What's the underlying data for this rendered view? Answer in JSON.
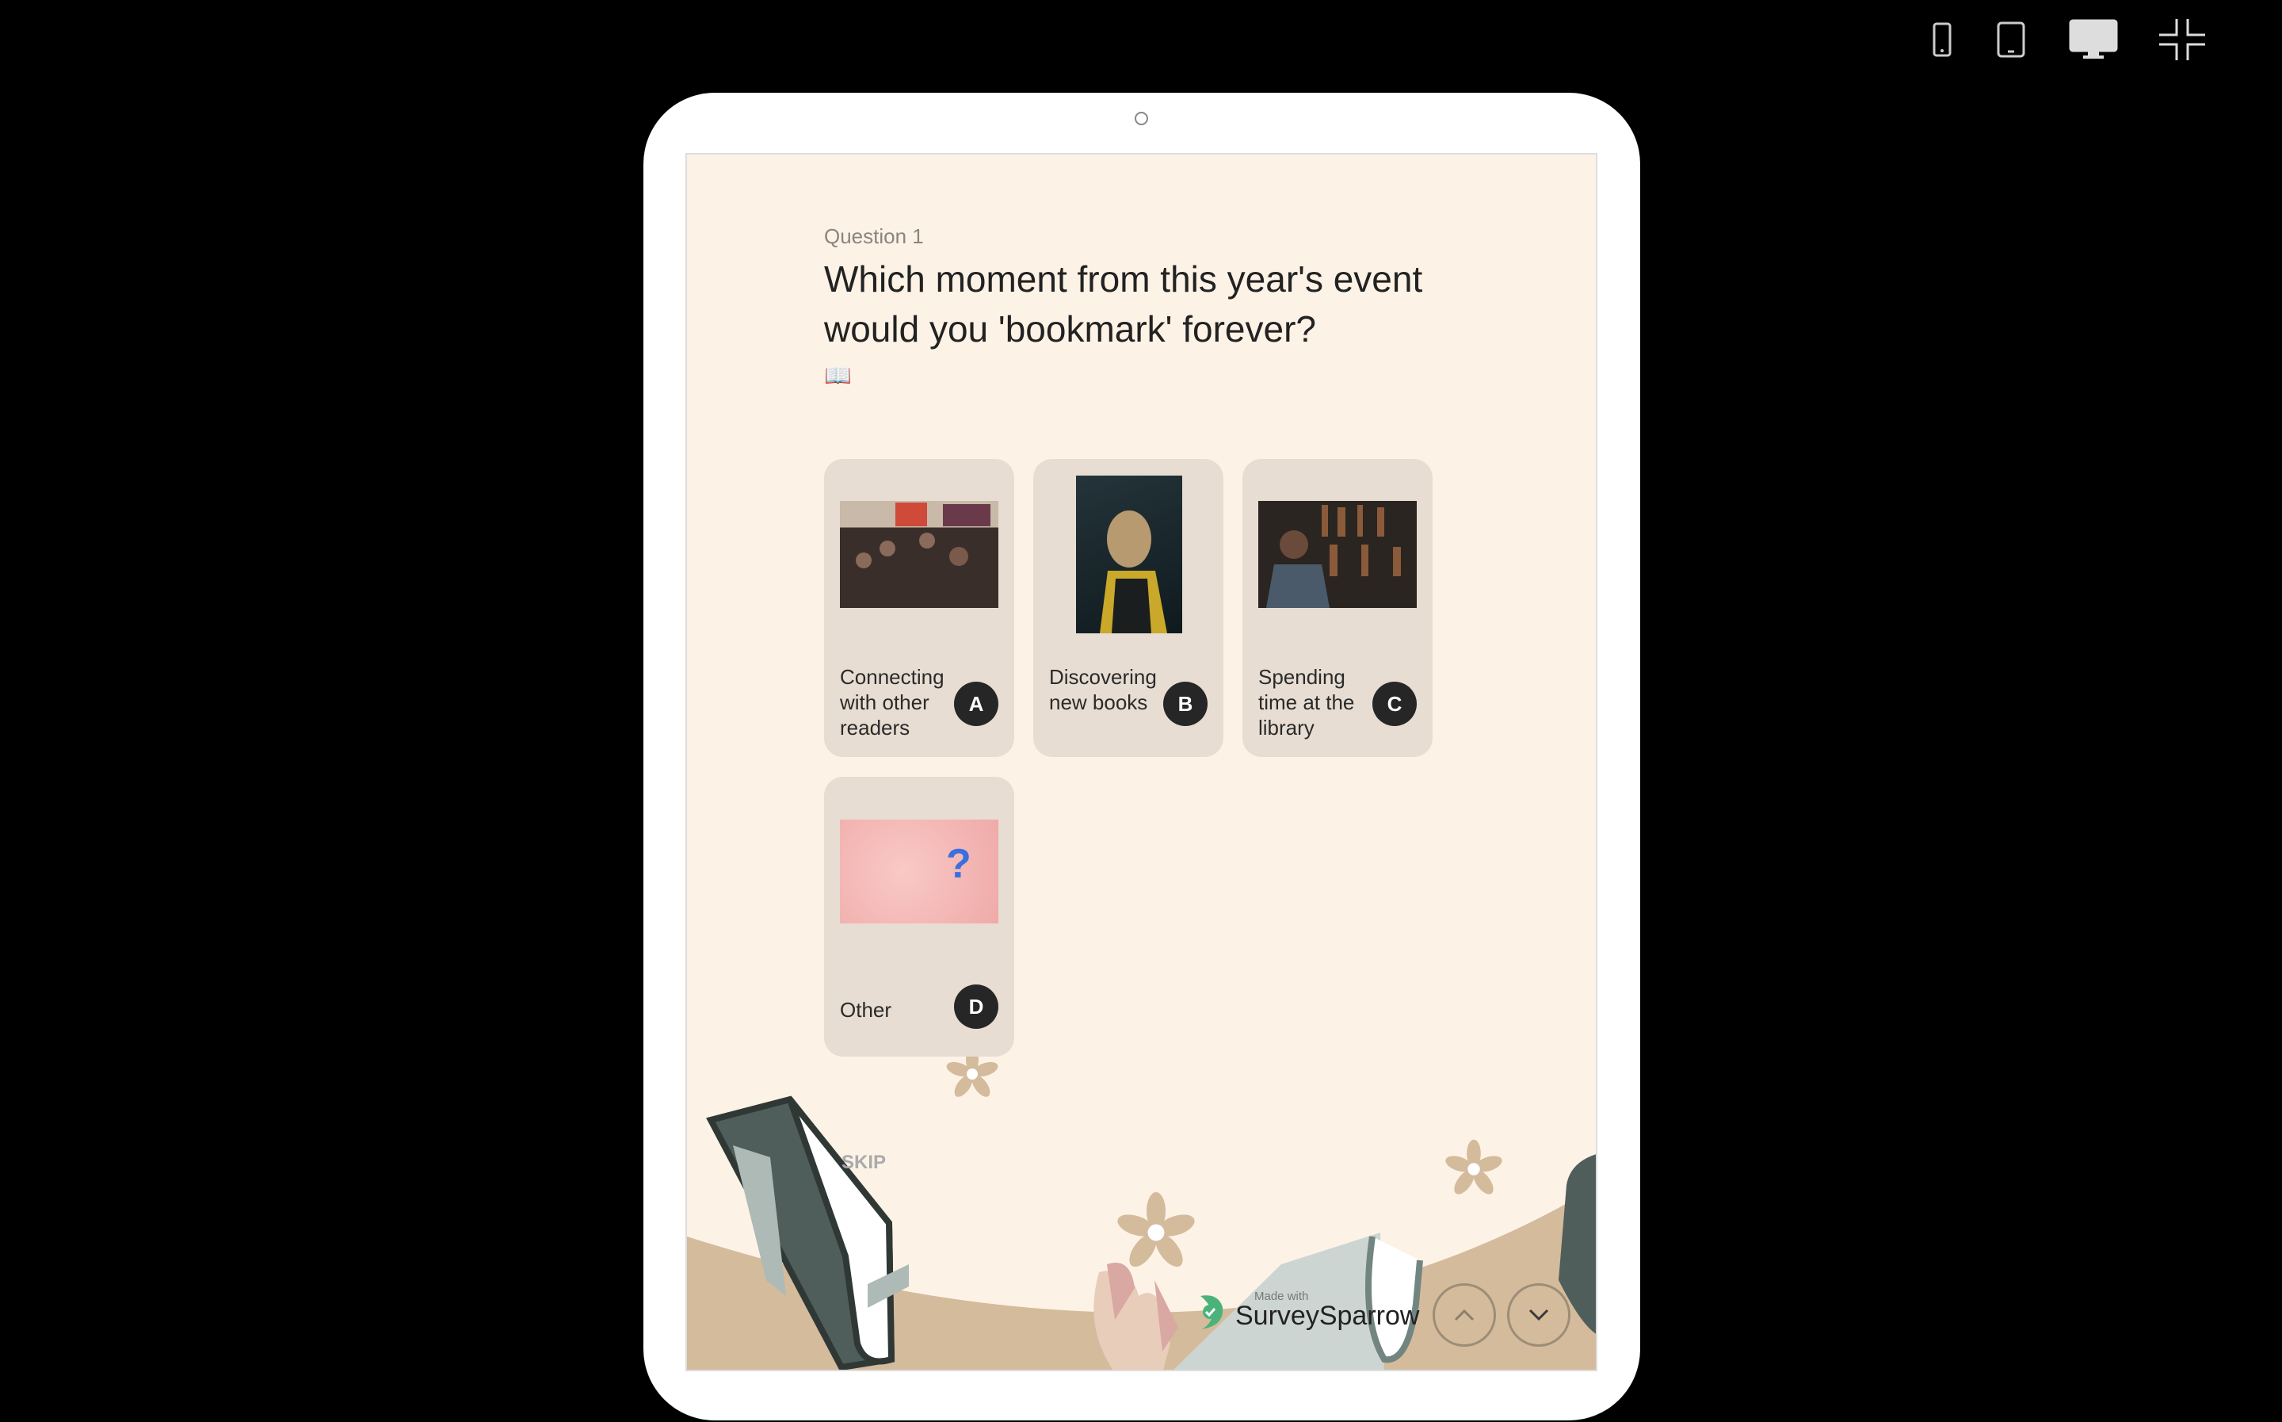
{
  "toolbar": {
    "icons": [
      "mobile-icon",
      "tablet-icon",
      "desktop-icon",
      "collapse-icon"
    ]
  },
  "survey": {
    "question_label": "Question 1",
    "question_title": "Which moment from this year's event would you 'bookmark' forever?",
    "emoji": "📖",
    "options": [
      {
        "label": "Connecting with other readers",
        "key": "A"
      },
      {
        "label": "Discovering new books",
        "key": "B"
      },
      {
        "label": "Spending time at the library",
        "key": "C"
      },
      {
        "label": "Other",
        "key": "D"
      }
    ],
    "skip_label": "SKIP",
    "branding": {
      "made_with": "Made with",
      "name": "SurveySparrow"
    }
  },
  "colors": {
    "background": "#fdf2e6",
    "card": "#e8ddd2",
    "badge": "#262626",
    "ground": "#d3bb9c"
  }
}
